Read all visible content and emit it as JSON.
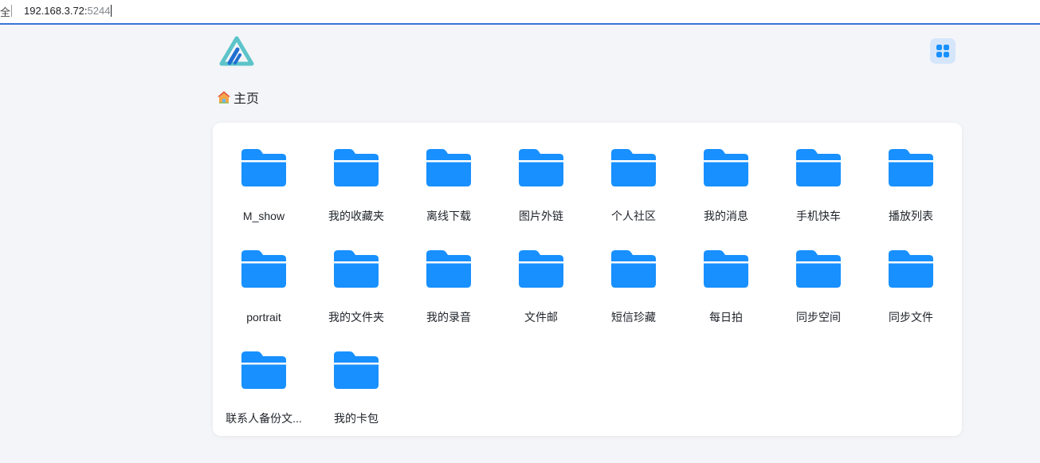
{
  "browser": {
    "left_glyph": "全",
    "url_host": "192.168.3.72:",
    "url_port": "5244"
  },
  "header": {
    "logo_icon": "alist-logo-icon",
    "view_toggle_icon": "grid-view-icon",
    "accent": "#1890ff"
  },
  "breadcrumb": {
    "icon": "home-icon",
    "label": "主页"
  },
  "folders": [
    {
      "name": "M_show"
    },
    {
      "name": "我的收藏夹"
    },
    {
      "name": "离线下载"
    },
    {
      "name": "图片外链"
    },
    {
      "name": "个人社区"
    },
    {
      "name": "我的消息"
    },
    {
      "name": "手机快车"
    },
    {
      "name": "播放列表"
    },
    {
      "name": "portrait"
    },
    {
      "name": "我的文件夹"
    },
    {
      "name": "我的录音"
    },
    {
      "name": "文件邮"
    },
    {
      "name": "短信珍藏"
    },
    {
      "name": "每日拍"
    },
    {
      "name": "同步空间"
    },
    {
      "name": "同步文件"
    },
    {
      "name": "联系人备份文..."
    },
    {
      "name": "我的卡包"
    }
  ]
}
